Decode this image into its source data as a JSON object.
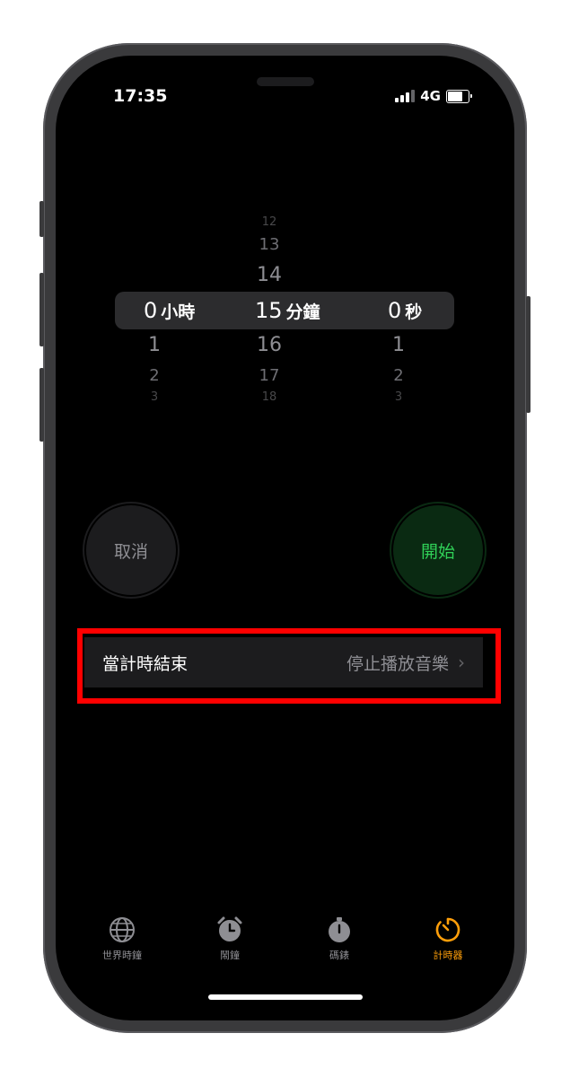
{
  "status_bar": {
    "time": "17:35",
    "network": "4G"
  },
  "picker": {
    "hours": {
      "above": [
        "",
        "",
        ""
      ],
      "selected": "0",
      "unit": "小時",
      "below": [
        "1",
        "2",
        "3"
      ]
    },
    "minutes": {
      "above": [
        "12",
        "13",
        "14"
      ],
      "selected": "15",
      "unit": "分鐘",
      "below": [
        "16",
        "17",
        "18"
      ]
    },
    "seconds": {
      "above": [
        "",
        "",
        ""
      ],
      "selected": "0",
      "unit": "秒",
      "below": [
        "1",
        "2",
        "3"
      ]
    }
  },
  "buttons": {
    "cancel": "取消",
    "start": "開始"
  },
  "when_timer_ends": {
    "label": "當計時結束",
    "value": "停止播放音樂"
  },
  "tabs": [
    {
      "label": "世界時鐘",
      "icon": "globe-icon",
      "active": false
    },
    {
      "label": "鬧鐘",
      "icon": "alarm-clock-icon",
      "active": false
    },
    {
      "label": "碼錶",
      "icon": "stopwatch-icon",
      "active": false
    },
    {
      "label": "計時器",
      "icon": "timer-icon",
      "active": true
    }
  ],
  "colors": {
    "accent_active_tab": "#ff9f0a",
    "start_green": "#30d158",
    "highlight_red": "#ff0000"
  }
}
